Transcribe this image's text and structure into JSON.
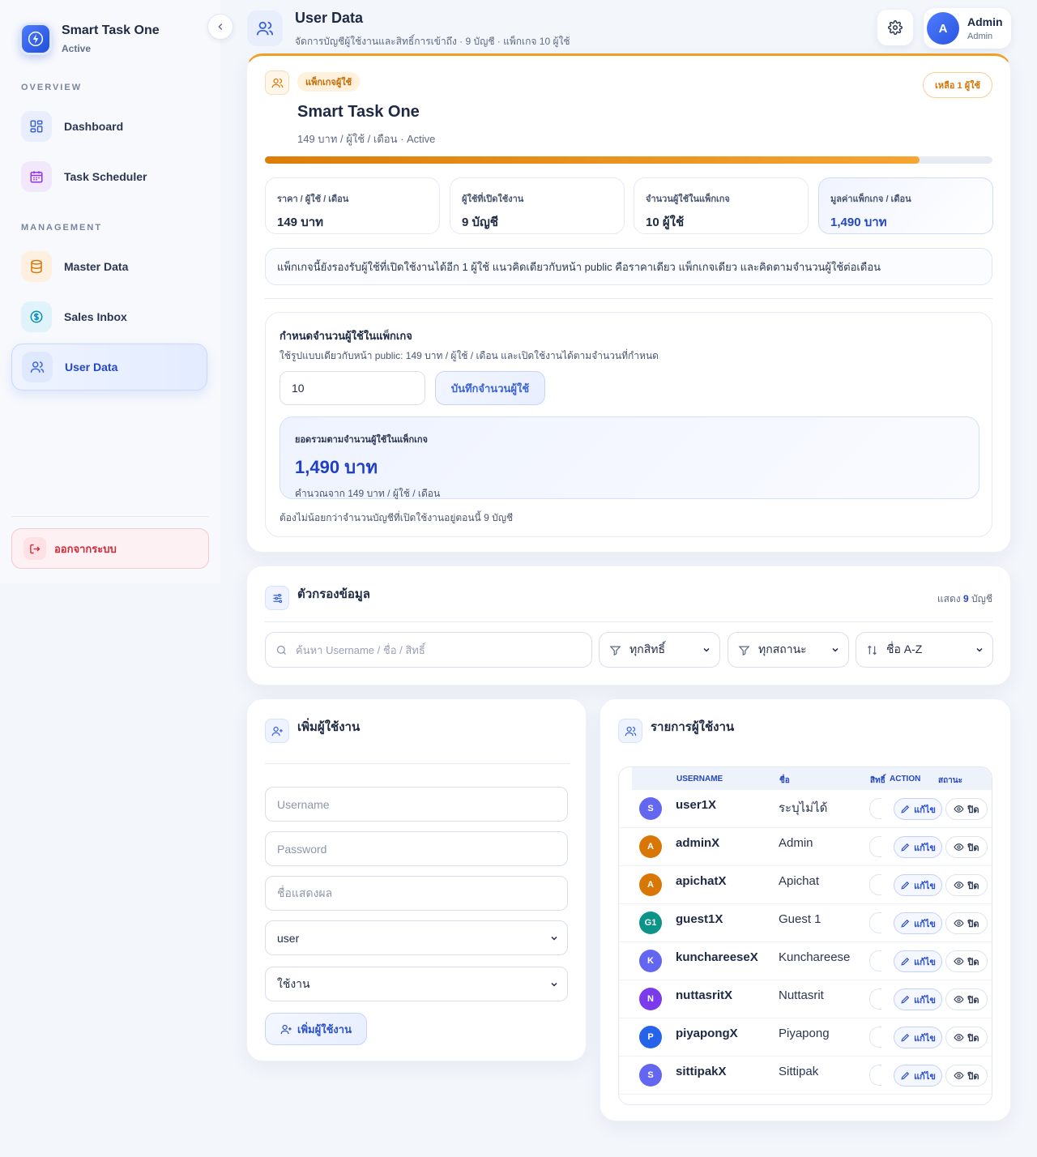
{
  "sidebar": {
    "brand_title": "Smart Task One",
    "brand_sub": "Active",
    "section_overview": "OVERVIEW",
    "section_management": "MANAGEMENT",
    "items": [
      {
        "label": "Dashboard",
        "icon": "grid-icon"
      },
      {
        "label": "Task Scheduler",
        "icon": "calendar-icon"
      },
      {
        "label": "Master Data",
        "icon": "database-icon"
      },
      {
        "label": "Sales Inbox",
        "icon": "dollar-icon"
      },
      {
        "label": "User Data",
        "icon": "users-icon",
        "active": true
      }
    ],
    "logout_label": "ออกจากระบบ"
  },
  "header": {
    "title": "User Data",
    "subtitle": "จัดการบัญชีผู้ใช้งานและสิทธิ์การเข้าถึง · 9 บัญชี · แพ็กเกจ 10 ผู้ใช้",
    "user_initial": "A",
    "user_name": "Admin",
    "user_role": "Admin"
  },
  "package": {
    "badge": "แพ็กเกจผู้ใช้",
    "remaining": "เหลือ 1 ผู้ใช้",
    "title": "Smart Task One",
    "meta": "149 บาท / ผู้ใช้ / เดือน · Active",
    "usage_fraction": 0.9,
    "stats": [
      {
        "label": "ราคา / ผู้ใช้ / เดือน",
        "value": "149 บาท"
      },
      {
        "label": "ผู้ใช้ที่เปิดใช้งาน",
        "value": "9 บัญชี"
      },
      {
        "label": "จำนวนผู้ใช้ในแพ็กเกจ",
        "value": "10 ผู้ใช้"
      },
      {
        "label": "มูลค่าแพ็กเกจ / เดือน",
        "value": "1,490 บาท"
      }
    ],
    "note": "แพ็กเกจนี้ยังรองรับผู้ใช้ที่เปิดใช้งานได้อีก 1 ผู้ใช้ แนวคิดเดียวกับหน้า public คือราคาเดียว แพ็กเกจเดียว และคิดตามจำนวนผู้ใช้ต่อเดือน",
    "seat": {
      "title": "กำหนดจำนวนผู้ใช้ในแพ็กเกจ",
      "sub": "ใช้รูปแบบเดียวกับหน้า public: 149 บาท / ผู้ใช้ / เดือน และเปิดใช้งานได้ตามจำนวนที่กำหนด",
      "input_value": "10",
      "save_label": "บันทึกจำนวนผู้ใช้",
      "total_label": "ยอดรวมตามจำนวนผู้ใช้ในแพ็กเกจ",
      "total_value": "1,490 บาท",
      "total_sub": "คำนวณจาก 149 บาท / ผู้ใช้ / เดือน",
      "foot": "ต้องไม่น้อยกว่าจำนวนบัญชีที่เปิดใช้งานอยู่ตอนนี้ 9 บัญชี"
    }
  },
  "filter": {
    "title": "ตัวกรองข้อมูล",
    "showing_prefix": "แสดง",
    "showing_count": "9",
    "showing_suffix": "บัญชี",
    "search_placeholder": "ค้นหา Username / ชื่อ / สิทธิ์",
    "role_select": "ทุกสิทธิ์",
    "status_select": "ทุกสถานะ",
    "sort_select": "ชื่อ A-Z"
  },
  "add_user": {
    "title": "เพิ่มผู้ใช้งาน",
    "username_placeholder": "Username",
    "password_placeholder": "Password",
    "display_placeholder": "ชื่อแสดงผล",
    "role_value": "user",
    "status_value": "ใช้งาน",
    "submit_label": "เพิ่มผู้ใช้งาน"
  },
  "user_list": {
    "title": "รายการผู้ใช้งาน",
    "columns": {
      "username": "USERNAME",
      "name": "ชื่อ",
      "role": "สิทธิ์",
      "action": "ACTION",
      "status": "สถานะ"
    },
    "edit_label": "แก้ไข",
    "off_label": "ปิด",
    "rows": [
      {
        "initial": "S",
        "username": "user1X",
        "name": "ระบุไม่ได้",
        "color": "#6366f1"
      },
      {
        "initial": "A",
        "username": "adminX",
        "name": "Admin",
        "color": "#d97706"
      },
      {
        "initial": "A",
        "username": "apichatX",
        "name": "Apichat",
        "color": "#d97706"
      },
      {
        "initial": "G1",
        "username": "guest1X",
        "name": "Guest 1",
        "color": "#0d9488"
      },
      {
        "initial": "K",
        "username": "kunchareeseX",
        "name": "Kunchareese",
        "color": "#6366f1"
      },
      {
        "initial": "N",
        "username": "nuttasritX",
        "name": "Nuttasrit",
        "color": "#7c3aed"
      },
      {
        "initial": "P",
        "username": "piyapongX",
        "name": "Piyapong",
        "color": "#2563eb"
      },
      {
        "initial": "S",
        "username": "sittipakX",
        "name": "Sittipak",
        "color": "#6366f1"
      }
    ]
  }
}
